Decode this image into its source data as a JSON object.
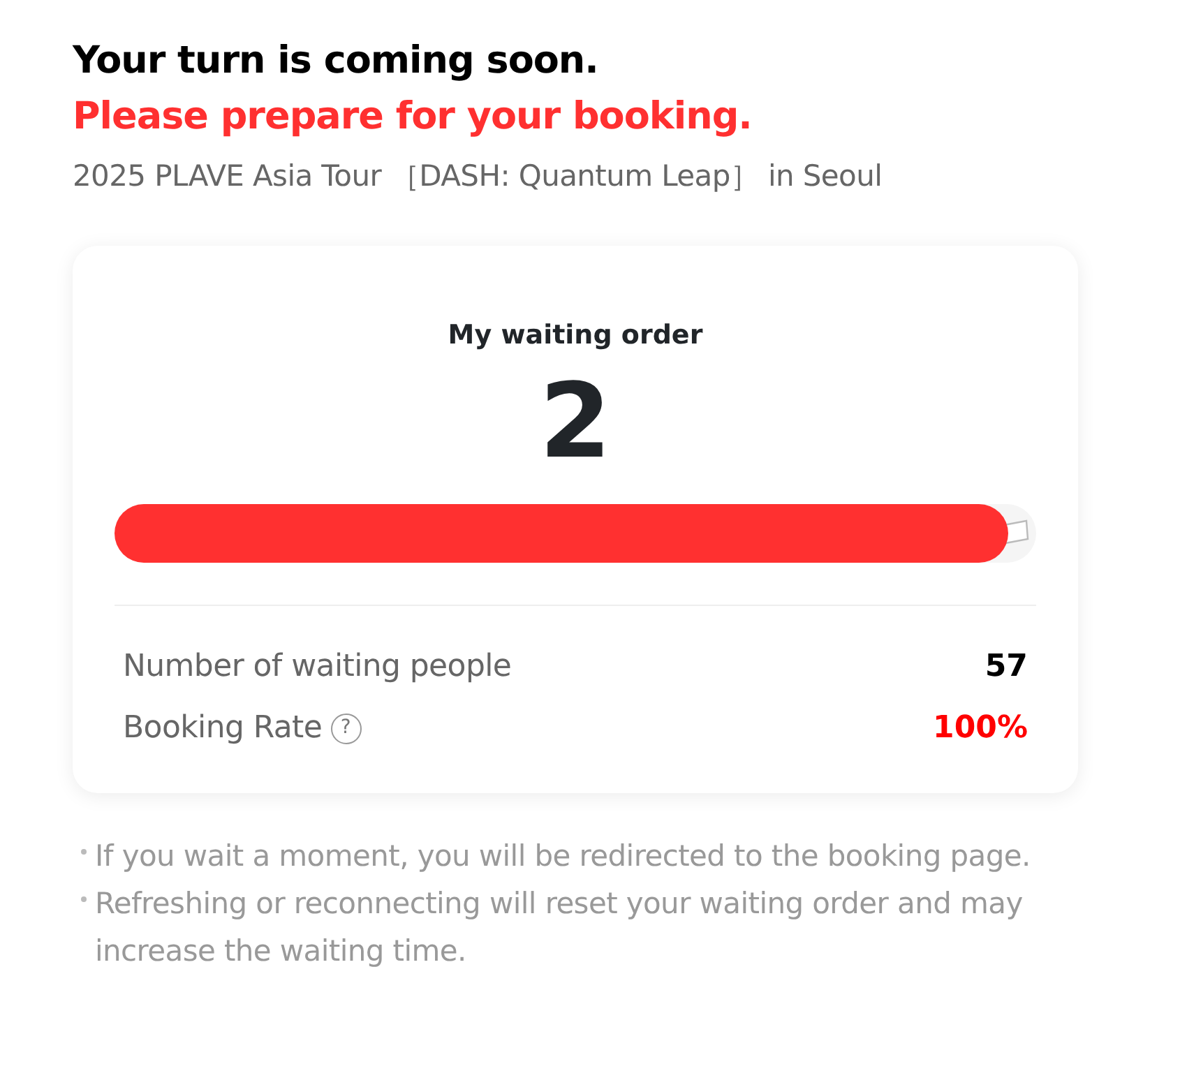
{
  "heading": "Your turn is coming soon.",
  "subheading": "Please prepare for your booking.",
  "event_title": "2025 PLAVE Asia Tour ［DASH: Quantum Leap］ in Seoul",
  "queue_card": {
    "label": "My waiting order",
    "order": "2",
    "progress": {
      "level": 0.97
    },
    "stats": [
      {
        "label": "Number of waiting people",
        "value": "57",
        "highlight": false
      },
      {
        "label": "Booking Rate",
        "help": "?",
        "value": "100%",
        "highlight": true
      }
    ]
  },
  "notes": [
    "If you wait a moment, you will be redirected to the booking page.",
    "Refreshing or reconnecting will reset your waiting order and may increase the waiting time."
  ]
}
